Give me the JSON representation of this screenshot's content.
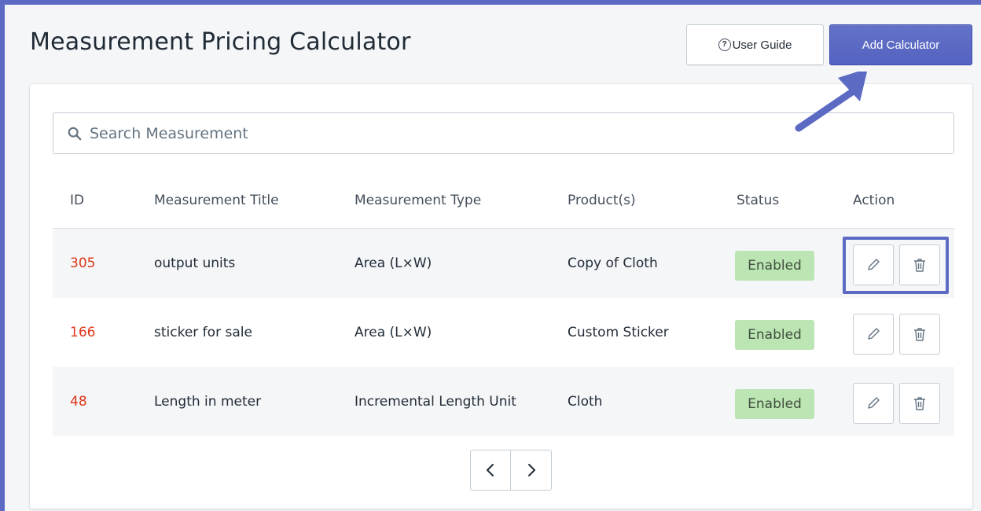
{
  "header": {
    "title": "Measurement Pricing Calculator",
    "user_guide_label": "User Guide",
    "add_calculator_label": "Add Calculator"
  },
  "search": {
    "placeholder": "Search Measurement",
    "value": ""
  },
  "table": {
    "columns": [
      "ID",
      "Measurement Title",
      "Measurement Type",
      "Product(s)",
      "Status",
      "Action"
    ],
    "rows": [
      {
        "id": "305",
        "title": "output units",
        "type": "Area (L×W)",
        "product": "Copy of Cloth",
        "status": "Enabled"
      },
      {
        "id": "166",
        "title": "sticker for sale",
        "type": "Area (L×W)",
        "product": "Custom Sticker",
        "status": "Enabled"
      },
      {
        "id": "48",
        "title": "Length in meter",
        "type": "Incremental Length Unit",
        "product": "Cloth",
        "status": "Enabled"
      }
    ]
  },
  "icons": {
    "search": "search-icon",
    "help": "question-circle-icon",
    "edit": "pencil-icon",
    "delete": "trash-icon",
    "prev": "chevron-left-icon",
    "next": "chevron-right-icon"
  },
  "colors": {
    "accent": "#5c6ac4",
    "id_text": "#de3618",
    "status_badge": "#bbe5b3"
  }
}
